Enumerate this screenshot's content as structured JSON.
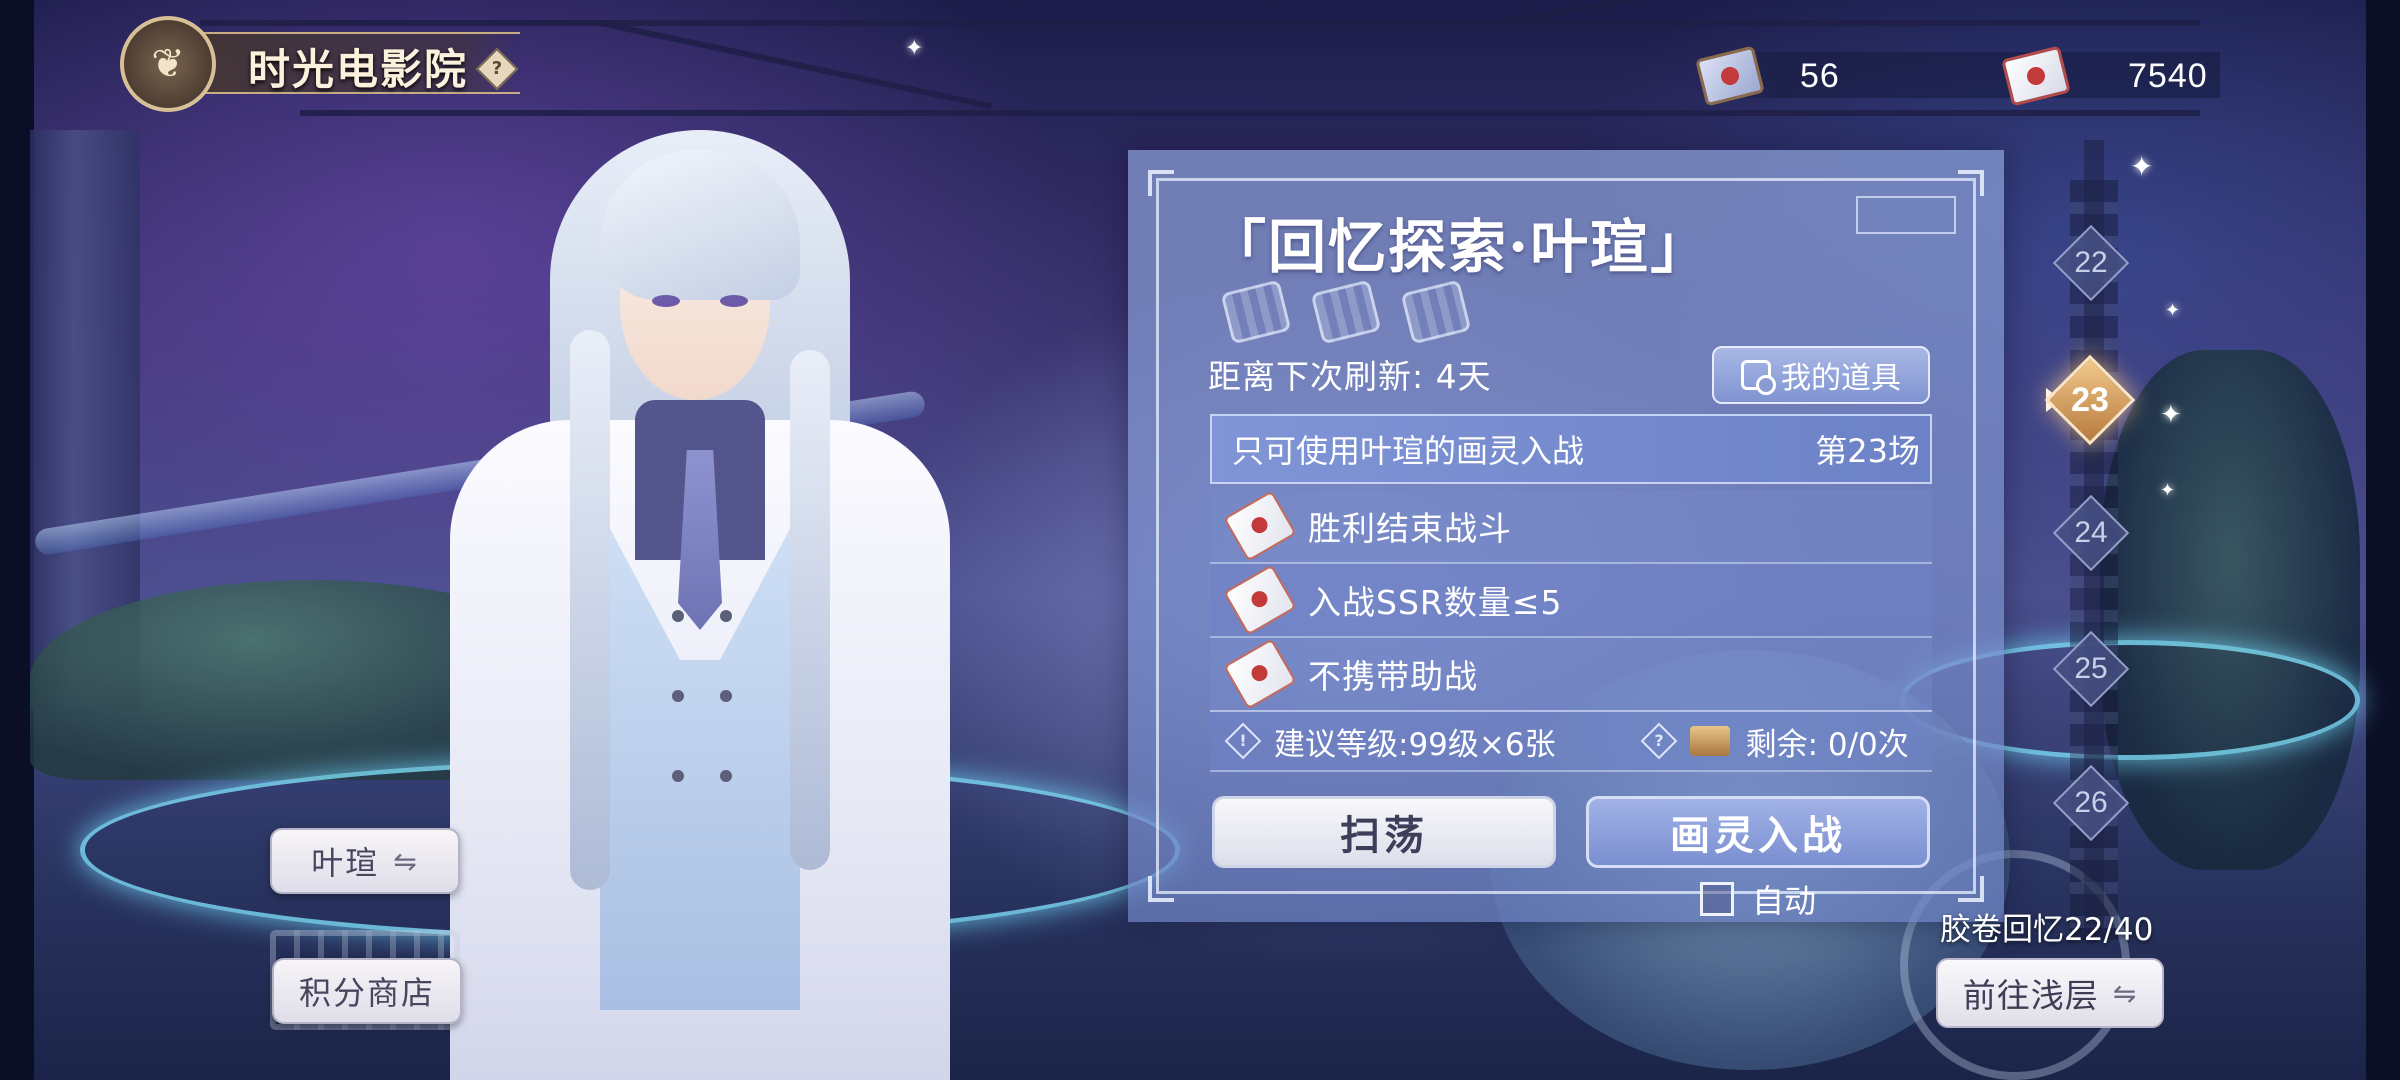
{
  "header": {
    "title": "时光电影院",
    "help_icon": "?"
  },
  "currencies": [
    {
      "icon": "film-ticket-icon",
      "value": "56"
    },
    {
      "icon": "ticket-icon",
      "value": "7540"
    }
  ],
  "character": {
    "name_button": "叶瑄",
    "switch_icon": "⇋"
  },
  "left_menu": {
    "points_shop": "积分商店"
  },
  "panel": {
    "title": "「回忆探索·叶瑄」",
    "refresh_text": "距离下次刷新: 4天",
    "my_items": "我的道具",
    "restriction": "只可使用叶瑄的画灵入战",
    "stage_label": "第23场",
    "conditions": [
      {
        "text": "胜利结束战斗"
      },
      {
        "text": "入战SSR数量≤5"
      },
      {
        "text": "不携带助战"
      }
    ],
    "recommend": "建议等级:99级×6张",
    "remaining": "剩余: 0/0次",
    "sweep_button": "扫荡",
    "enter_button": "画灵入战",
    "auto_label": "自动",
    "auto_checked": false
  },
  "levels": [
    {
      "num": "22",
      "active": false
    },
    {
      "num": "23",
      "active": true
    },
    {
      "num": "24",
      "active": false
    },
    {
      "num": "25",
      "active": false
    },
    {
      "num": "26",
      "active": false
    }
  ],
  "footer": {
    "progress": "胶卷回忆22/40",
    "goto_button": "前往浅层",
    "goto_icon": "⇋"
  },
  "colors": {
    "panel_bg": "#8a9fd6",
    "active_level": "#e2ab6a",
    "button_light": "#f4f3f7"
  }
}
